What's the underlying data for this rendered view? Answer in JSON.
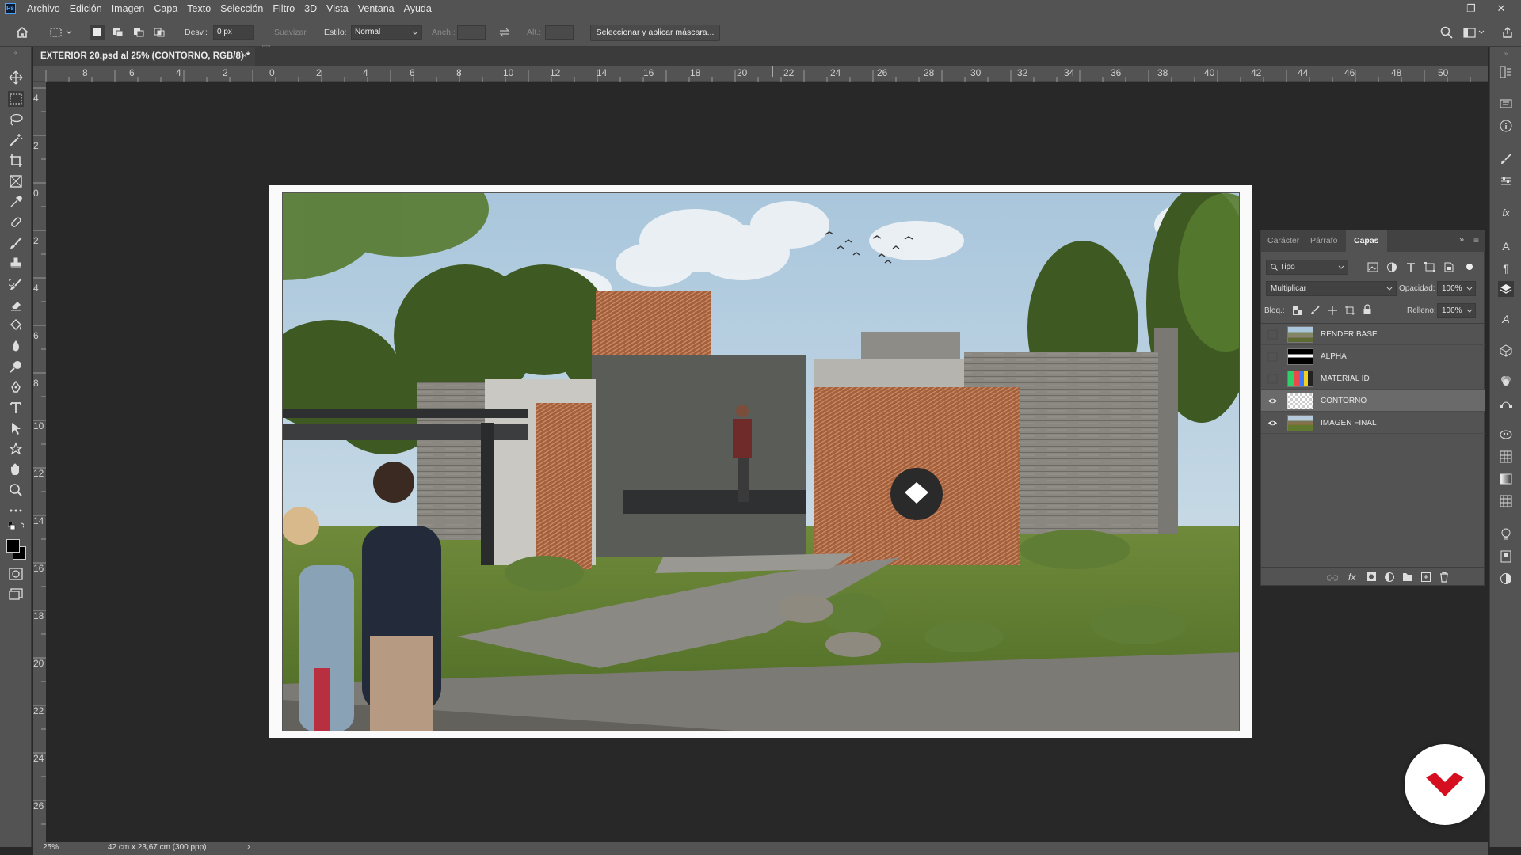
{
  "menubar": {
    "items": [
      "Archivo",
      "Edición",
      "Imagen",
      "Capa",
      "Texto",
      "Selección",
      "Filtro",
      "3D",
      "Vista",
      "Ventana",
      "Ayuda"
    ]
  },
  "options": {
    "feather_label": "Desv.:",
    "feather_value": "0 px",
    "smooth_label": "Suavizar",
    "style_label": "Estilo:",
    "style_value": "Normal",
    "width_label": "Anch.:",
    "height_label": "Alt.:",
    "mask_button": "Seleccionar y aplicar máscara..."
  },
  "document": {
    "tab_title": "EXTERIOR 20.psd al 25% (CONTORNO, RGB/8) *"
  },
  "rulers": {
    "horizontal": [
      "8",
      "6",
      "4",
      "2",
      "0",
      "2",
      "4",
      "6",
      "8",
      "10",
      "12",
      "14",
      "16",
      "18",
      "20",
      "22",
      "24",
      "26",
      "28",
      "30",
      "32",
      "34",
      "36",
      "38",
      "40",
      "42",
      "44",
      "46",
      "48",
      "50"
    ],
    "vertical": [
      "4",
      "2",
      "0",
      "2",
      "4",
      "6",
      "8",
      "10",
      "12",
      "14",
      "16",
      "18",
      "20",
      "22",
      "24",
      "26"
    ]
  },
  "layers_panel": {
    "tabs": [
      "Carácter",
      "Párrafo",
      "Capas"
    ],
    "active_tab": "Capas",
    "filter": "Tipo",
    "blend_mode": "Multiplicar",
    "opacity_label": "Opacidad:",
    "opacity_value": "100%",
    "lock_label": "Bloq.:",
    "fill_label": "Relleno:",
    "fill_value": "100%",
    "layers": [
      {
        "name": "RENDER BASE",
        "visible": false,
        "selected": false
      },
      {
        "name": "ALPHA",
        "visible": false,
        "selected": false
      },
      {
        "name": "MATERIAL ID",
        "visible": false,
        "selected": false
      },
      {
        "name": "CONTORNO",
        "visible": true,
        "selected": true
      },
      {
        "name": "IMAGEN FINAL",
        "visible": true,
        "selected": false
      }
    ]
  },
  "status": {
    "zoom": "25%",
    "doc_size": "42 cm x 23,67 cm (300 ppp)"
  },
  "colors": {
    "ui_bg": "#535353",
    "canvas_bg": "#282828",
    "badge_red": "#d50f1f"
  }
}
